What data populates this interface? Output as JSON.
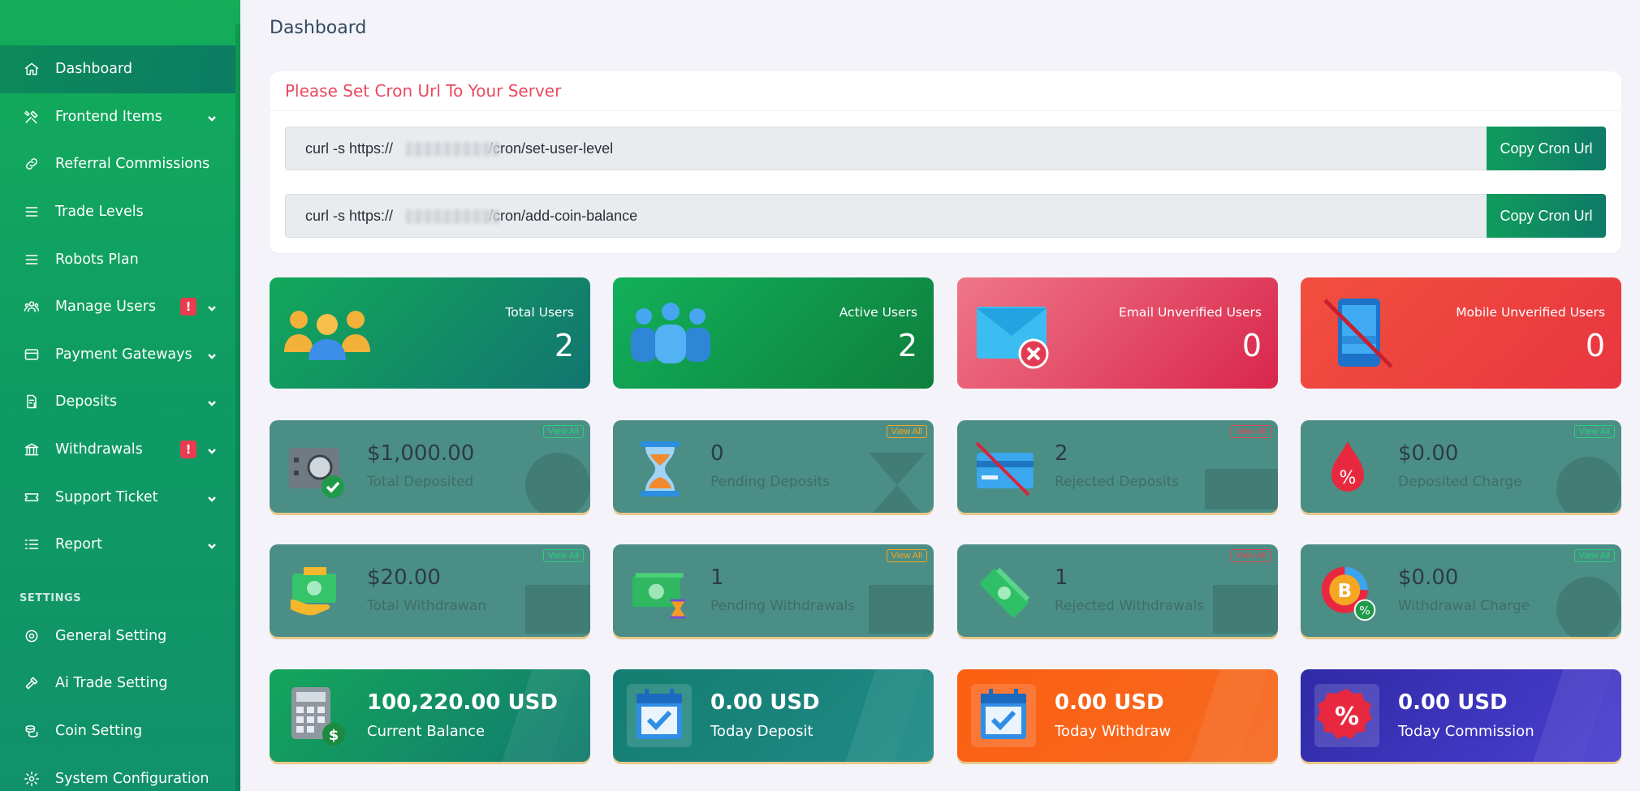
{
  "sidebar": {
    "items": [
      {
        "label": "Dashboard",
        "icon": "home-icon"
      },
      {
        "label": "Frontend Items",
        "icon": "tools-icon"
      },
      {
        "label": "Referral Commissions",
        "icon": "link-icon"
      },
      {
        "label": "Trade Levels",
        "icon": "list-icon"
      },
      {
        "label": "Robots Plan",
        "icon": "list-icon"
      },
      {
        "label": "Manage Users",
        "icon": "users-icon",
        "alert": "!"
      },
      {
        "label": "Payment Gateways",
        "icon": "credit-card-icon"
      },
      {
        "label": "Deposits",
        "icon": "file-dollar-icon"
      },
      {
        "label": "Withdrawals",
        "icon": "bank-icon",
        "alert": "!"
      },
      {
        "label": "Support Ticket",
        "icon": "ticket-icon"
      },
      {
        "label": "Report",
        "icon": "list-check-icon"
      }
    ],
    "settings_heading": "SETTINGS",
    "settings_items": [
      {
        "label": "General Setting",
        "icon": "settings-circle-icon"
      },
      {
        "label": "Ai Trade Setting",
        "icon": "hammer-icon"
      },
      {
        "label": "Coin Setting",
        "icon": "coins-icon"
      },
      {
        "label": "System Configuration",
        "icon": "gear-icon"
      }
    ]
  },
  "page": {
    "title": "Dashboard"
  },
  "cron": {
    "title": "Please Set Cron Url To Your Server",
    "rows": [
      {
        "prefix": "curl -s https://",
        "suffix": "/cron/set-user-level",
        "button": "Copy Cron Url"
      },
      {
        "prefix": "curl -s https://",
        "suffix": "/cron/add-coin-balance",
        "button": "Copy Cron Url"
      }
    ]
  },
  "top_stats": [
    {
      "label": "Total Users",
      "value": "2"
    },
    {
      "label": "Active Users",
      "value": "2"
    },
    {
      "label": "Email Unverified Users",
      "value": "0"
    },
    {
      "label": "Mobile Unverified Users",
      "value": "0"
    }
  ],
  "deposit_stats": [
    {
      "value": "$1,000.00",
      "label": "Total Deposited",
      "view_all": "View All"
    },
    {
      "value": "0",
      "label": "Pending Deposits",
      "view_all": "View All"
    },
    {
      "value": "2",
      "label": "Rejected Deposits",
      "view_all": "View All"
    },
    {
      "value": "$0.00",
      "label": "Deposited Charge",
      "view_all": "View All"
    }
  ],
  "withdraw_stats": [
    {
      "value": "$20.00",
      "label": "Total Withdrawan",
      "view_all": "View All"
    },
    {
      "value": "1",
      "label": "Pending Withdrawals",
      "view_all": "View All"
    },
    {
      "value": "1",
      "label": "Rejected Withdrawals",
      "view_all": "View All"
    },
    {
      "value": "$0.00",
      "label": "Withdrawal Charge",
      "view_all": "View All"
    }
  ],
  "balance_stats": [
    {
      "value": "100,220.00 USD",
      "label": "Current Balance"
    },
    {
      "value": "0.00 USD",
      "label": "Today Deposit"
    },
    {
      "value": "0.00 USD",
      "label": "Today Withdraw"
    },
    {
      "value": "0.00 USD",
      "label": "Today Commission"
    }
  ],
  "colors": {
    "sidebar": "#14ad5a",
    "accent_red": "#e84a5f",
    "copy_button": "#109c5d",
    "mid_card": "#4b8e86"
  }
}
